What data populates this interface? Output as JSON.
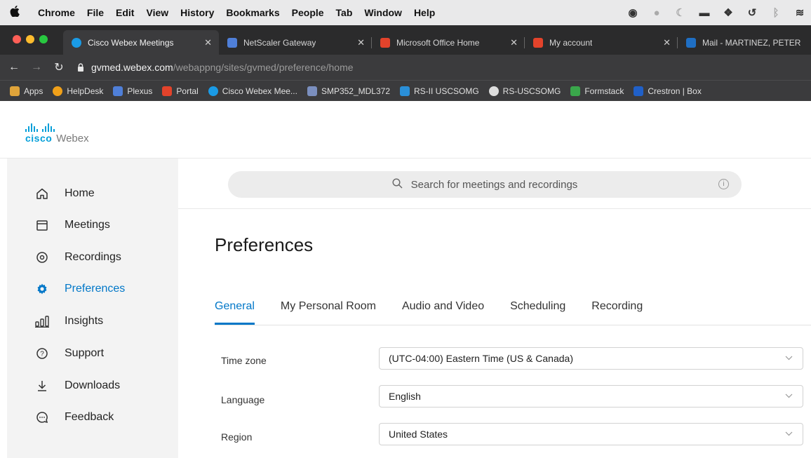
{
  "menubar": {
    "app": "Chrome",
    "items": [
      "File",
      "Edit",
      "View",
      "History",
      "Bookmarks",
      "People",
      "Tab",
      "Window",
      "Help"
    ]
  },
  "tabs": [
    {
      "title": "Cisco Webex Meetings",
      "color": "#1a9be6",
      "active": true
    },
    {
      "title": "NetScaler Gateway",
      "color": "#4f7fd8",
      "active": false
    },
    {
      "title": "Microsoft Office Home",
      "color": "#e3432b",
      "active": false
    },
    {
      "title": "My account",
      "color": "#e3432b",
      "active": false
    },
    {
      "title": "Mail - MARTINEZ, PETER",
      "color": "#1f6fc4",
      "active": false
    }
  ],
  "address": {
    "host": "gvmed.webex.com",
    "path": "/webappng/sites/gvmed/preference/home"
  },
  "bookmarks": [
    {
      "label": "Apps",
      "color": "#e0a43a"
    },
    {
      "label": "HelpDesk",
      "color": "#f0a019"
    },
    {
      "label": "Plexus",
      "color": "#4f7fd8"
    },
    {
      "label": "Portal",
      "color": "#e3432b"
    },
    {
      "label": "Cisco Webex Mee...",
      "color": "#1a9be6"
    },
    {
      "label": "SMP352_MDL372",
      "color": "#7b8fbf"
    },
    {
      "label": "RS-II USCSOMG",
      "color": "#2a8fd8"
    },
    {
      "label": "RS-USCSOMG",
      "color": "#dddddd"
    },
    {
      "label": "Formstack",
      "color": "#3aa74b"
    },
    {
      "label": "Crestron | Box",
      "color": "#2060c8"
    }
  ],
  "logo": {
    "cisco": "cisco",
    "product": "Webex"
  },
  "sidebar": {
    "items": [
      {
        "label": "Home",
        "icon": "home-icon"
      },
      {
        "label": "Meetings",
        "icon": "calendar-icon"
      },
      {
        "label": "Recordings",
        "icon": "recordings-icon"
      },
      {
        "label": "Preferences",
        "icon": "gear-icon",
        "active": true
      },
      {
        "label": "Insights",
        "icon": "insights-icon"
      },
      {
        "label": "Support",
        "icon": "help-icon"
      },
      {
        "label": "Downloads",
        "icon": "download-icon"
      },
      {
        "label": "Feedback",
        "icon": "feedback-icon"
      }
    ]
  },
  "search": {
    "placeholder": "Search for meetings and recordings"
  },
  "main": {
    "title": "Preferences",
    "tabs": [
      "General",
      "My Personal Room",
      "Audio and Video",
      "Scheduling",
      "Recording"
    ],
    "active_tab": "General",
    "fields": [
      {
        "label": "Time zone",
        "value": "(UTC-04:00) Eastern Time (US & Canada)"
      },
      {
        "label": "Language",
        "value": "English"
      },
      {
        "label": "Region",
        "value": "United States"
      }
    ]
  },
  "colors": {
    "accent": "#0077c8",
    "cisco_blue": "#049fd9"
  }
}
